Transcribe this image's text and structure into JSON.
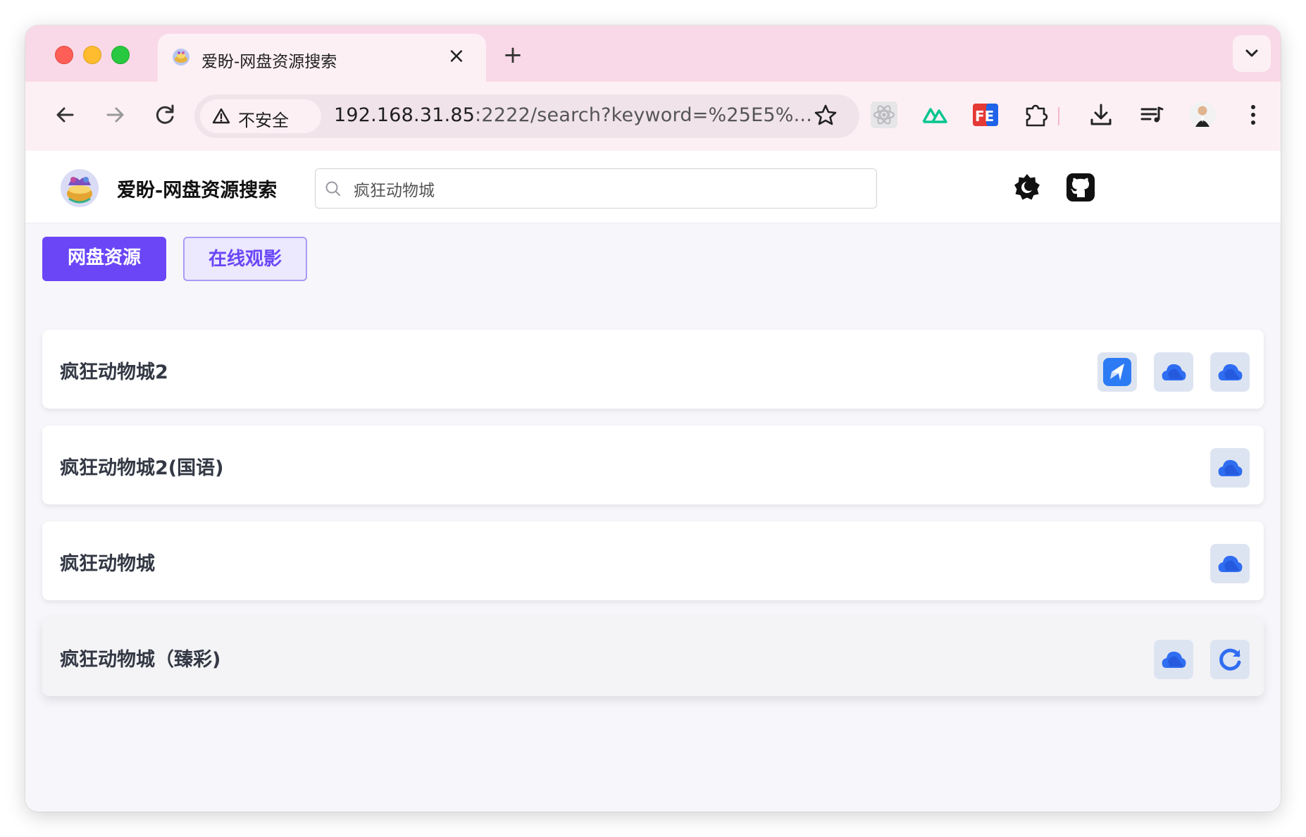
{
  "browser": {
    "tab_title": "爱盼-网盘资源搜索",
    "security_label": "不安全",
    "url_main": "192.168.31.85",
    "url_rest": ":2222/search?keyword=%25E5%..."
  },
  "header": {
    "site_title": "爱盼-网盘资源搜索",
    "search_value": "疯狂动物城"
  },
  "tabs": [
    {
      "label": "网盘资源",
      "active": true
    },
    {
      "label": "在线观影",
      "active": false
    }
  ],
  "results": [
    {
      "title": "疯狂动物城2",
      "icons": [
        "quark-drive-icon",
        "cloud-drive-icon",
        "cloud-drive-icon"
      ]
    },
    {
      "title": "疯狂动物城2(国语)",
      "icons": [
        "cloud-drive-icon"
      ]
    },
    {
      "title": "疯狂动物城",
      "icons": [
        "cloud-drive-icon"
      ]
    },
    {
      "title": "疯狂动物城（臻彩)",
      "icons": [
        "cloud-drive-icon",
        "refresh-drive-icon"
      ]
    }
  ],
  "colors": {
    "accent": "#6a46f6",
    "tabstrip": "#f9d9e7",
    "toolbar": "#fdf0f5"
  }
}
